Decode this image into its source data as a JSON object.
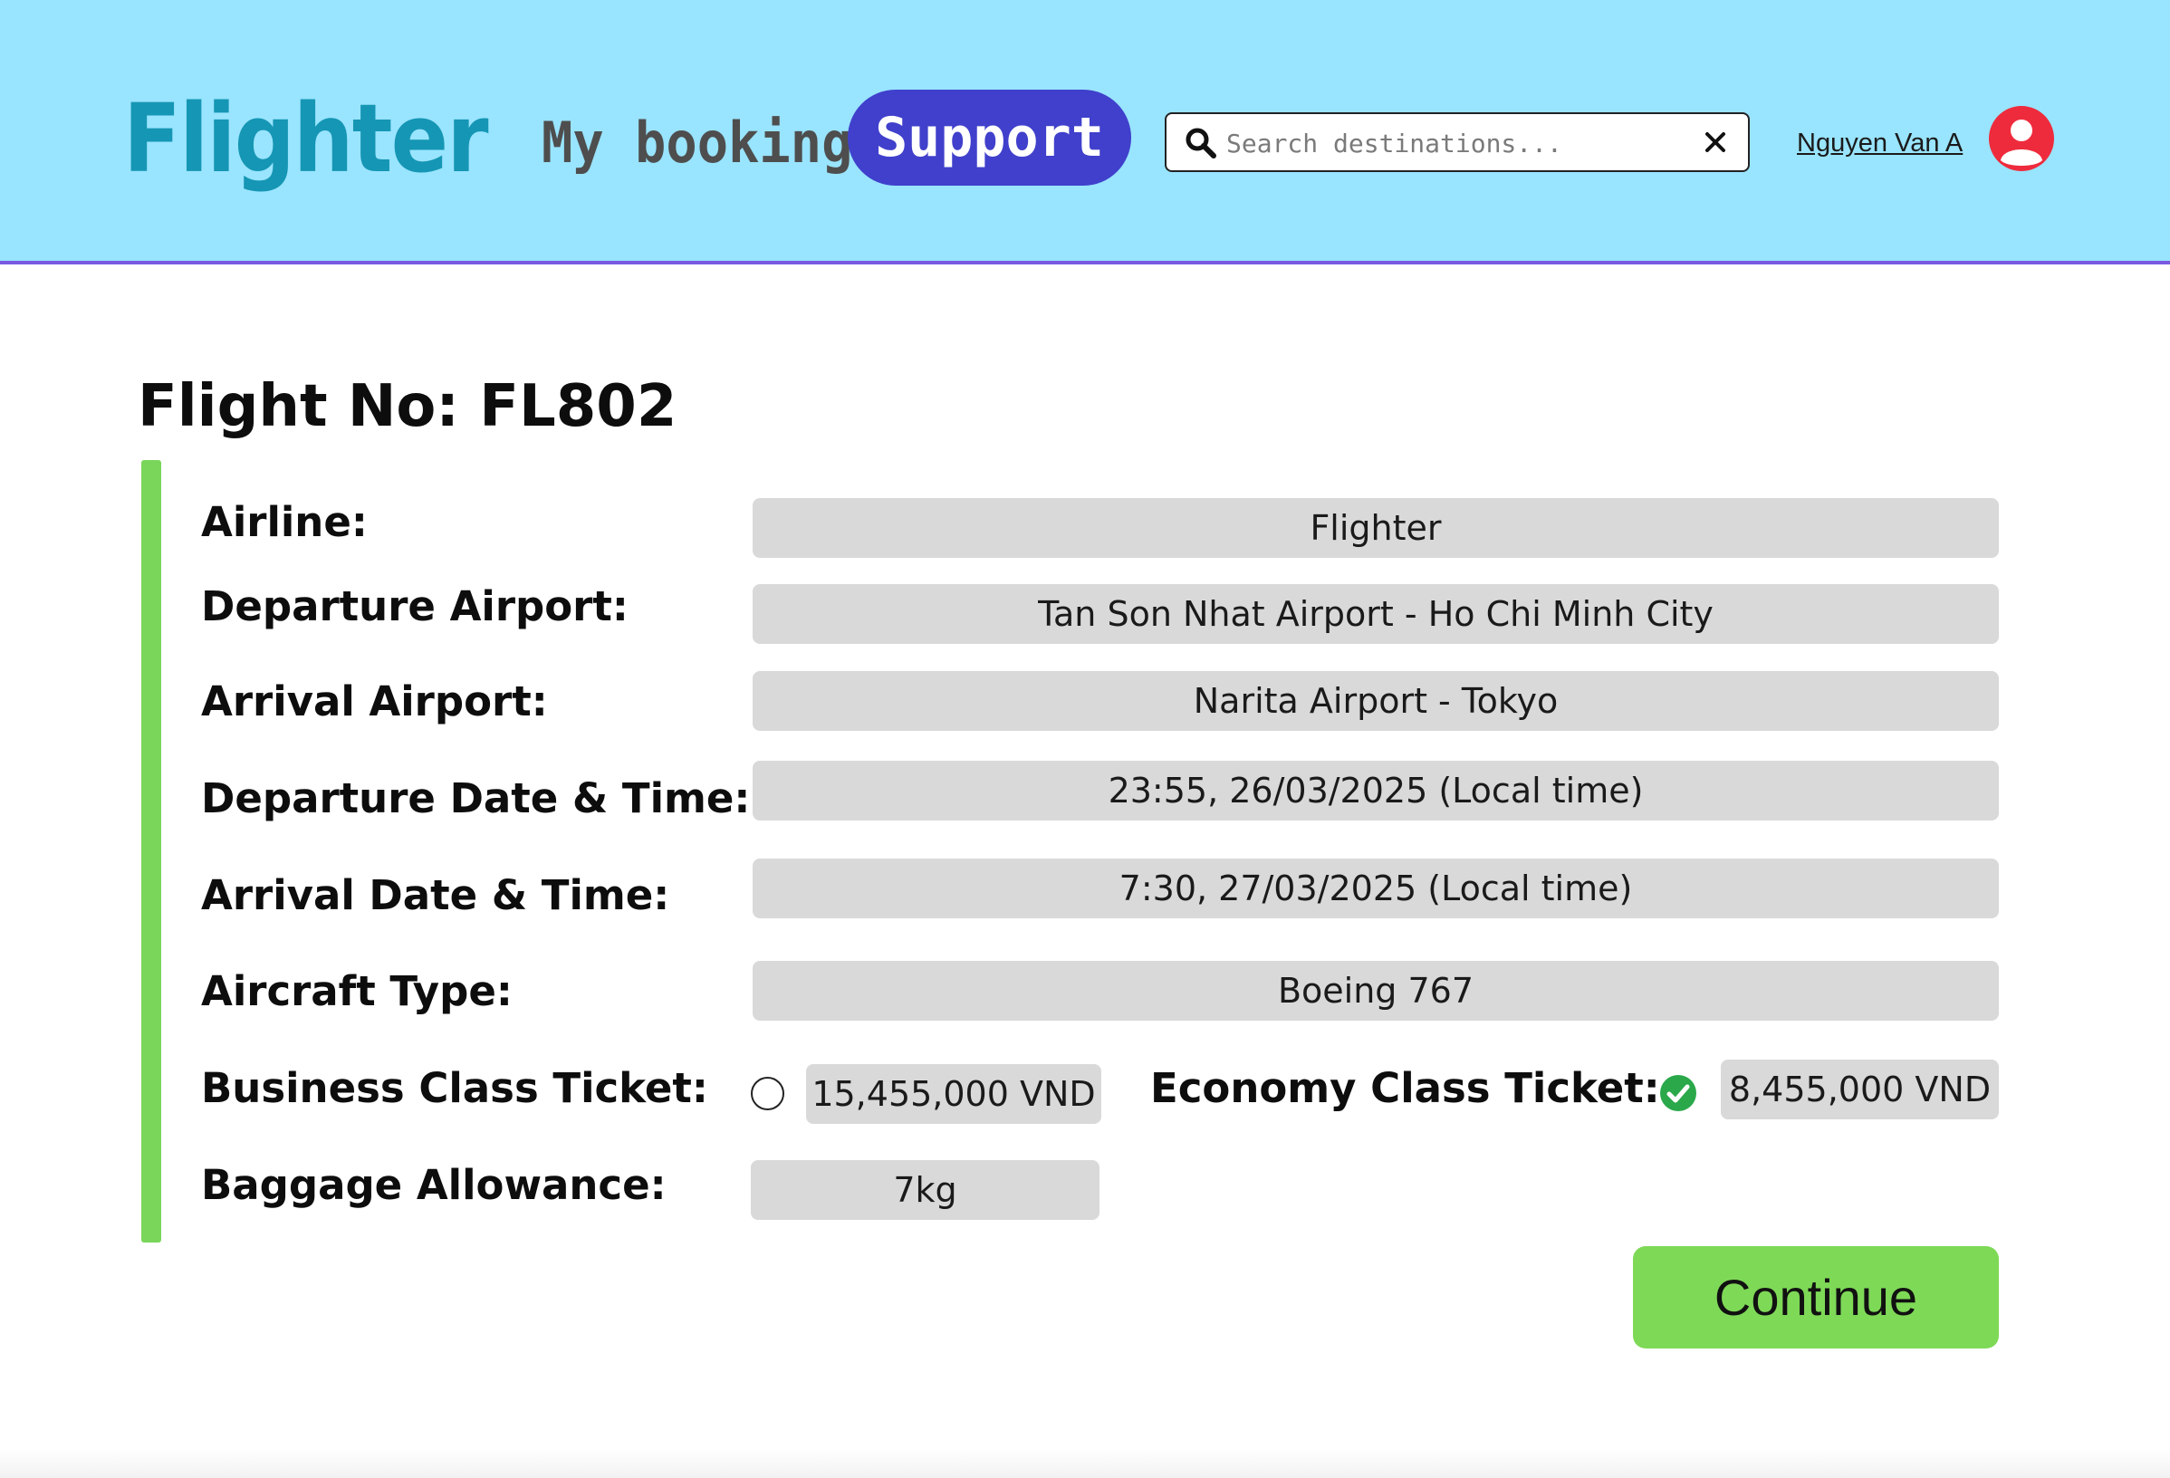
{
  "header": {
    "logo": "Flighter",
    "nav": {
      "my_booking": "My booking",
      "support": "Support"
    },
    "search": {
      "placeholder": "Search destinations..."
    },
    "user": {
      "name": "Nguyen Van A"
    }
  },
  "flight": {
    "title": "Flight No: FL802",
    "rows": [
      {
        "label": "Airline:",
        "value": "Flighter"
      },
      {
        "label": "Departure Airport:",
        "value": "Tan Son Nhat Airport - Ho Chi Minh City"
      },
      {
        "label": "Arrival Airport:",
        "value": "Narita Airport - Tokyo"
      },
      {
        "label": "Departure Date & Time:",
        "value": "23:55, 26/03/2025 (Local time)"
      },
      {
        "label": "Arrival Date & Time:",
        "value": "7:30, 27/03/2025 (Local time)"
      },
      {
        "label": "Aircraft Type:",
        "value": "Boeing 767"
      }
    ],
    "tickets": {
      "business_label": "Business Class Ticket:",
      "business_price": "15,455,000 VND",
      "business_selected": false,
      "economy_label": "Economy Class Ticket:",
      "economy_price": "8,455,000 VND",
      "economy_selected": true
    },
    "baggage": {
      "label": "Baggage Allowance:",
      "value": "7kg"
    }
  },
  "actions": {
    "continue_label": "Continue"
  },
  "colors": {
    "header_bg": "#99e4fe",
    "header_border": "#7a5ae0",
    "logo": "#1596b4",
    "support_button": "#4040cc",
    "accent_bar": "#7ad65a",
    "field_bg": "#d9d9d9",
    "continue_button": "#7ed957",
    "selected_check": "#2aa84a",
    "avatar": "#ee2b3c"
  },
  "icons": {
    "search": "search-icon",
    "clear": "close-icon",
    "avatar": "user-avatar-icon",
    "radio_checked": "check-circle-icon"
  }
}
